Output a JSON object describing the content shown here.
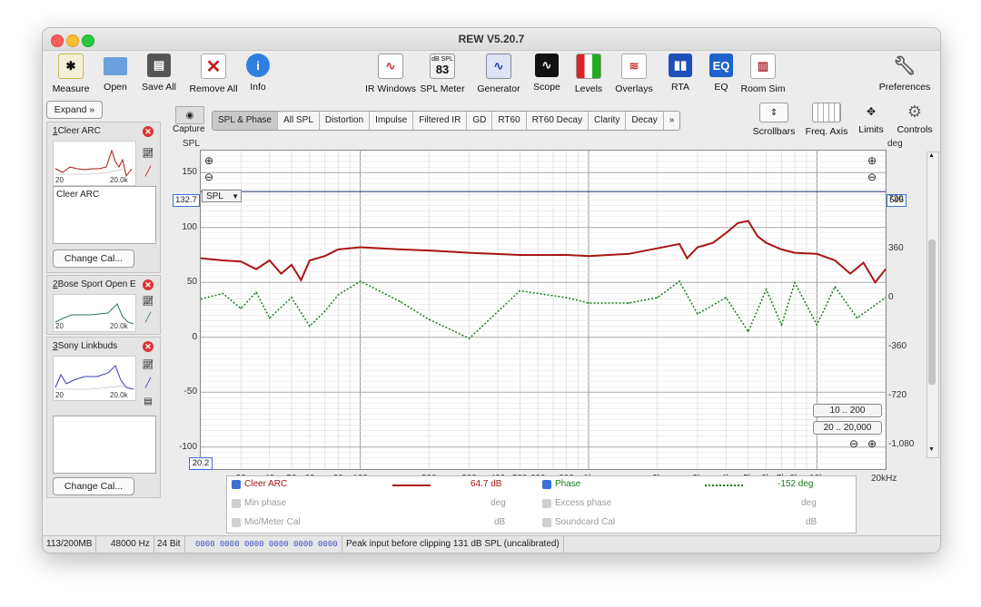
{
  "window": {
    "title": "REW V5.20.7"
  },
  "toolbar": {
    "measure": "Measure",
    "open": "Open",
    "save_all": "Save All",
    "remove_all": "Remove All",
    "info": "Info",
    "ir_windows": "IR Windows",
    "spl_meter": "SPL Meter",
    "spl_meter_top": "dB SPL",
    "spl_meter_value": "83",
    "generator": "Generator",
    "scope": "Scope",
    "levels": "Levels",
    "overlays": "Overlays",
    "rta": "RTA",
    "eq": "EQ",
    "eq_icon": "EQ",
    "room_sim": "Room Sim",
    "preferences": "Preferences"
  },
  "sidebar": {
    "expand": "Expand",
    "measurements": [
      {
        "num": "1",
        "name": "Cleer ARC",
        "note": "Cleer ARC",
        "axis_lo": "20",
        "axis_hi": "20.0k",
        "button": "Change Cal..."
      },
      {
        "num": "2",
        "name": "Bose Sport Open E",
        "axis_lo": "20",
        "axis_hi": "20.0k"
      },
      {
        "num": "3",
        "name": "Sony Linkbuds",
        "axis_lo": "20",
        "axis_hi": "20.0k",
        "button": "Change Cal..."
      }
    ]
  },
  "capture": "Capture",
  "tabs": [
    "SPL & Phase",
    "All SPL",
    "Distortion",
    "Impulse",
    "Filtered IR",
    "GD",
    "RT60",
    "RT60 Decay",
    "Clarity",
    "Decay",
    "»"
  ],
  "right_controls": {
    "scrollbars": "Scrollbars",
    "freq_axis": "Freq. Axis",
    "limits": "Limits",
    "controls": "Controls"
  },
  "chart": {
    "left_unit": "SPL",
    "right_unit": "deg",
    "left_ticks": [
      "150",
      "100",
      "50",
      "0",
      "-50",
      "-100"
    ],
    "right_ticks": [
      "720",
      "360",
      "0",
      "-360",
      "-720",
      "-1,080"
    ],
    "x_ticks": [
      "30",
      "40",
      "50",
      "60",
      "80",
      "100",
      "200",
      "300",
      "400",
      "500",
      "600",
      "800",
      "1k",
      "2k",
      "3k",
      "4k",
      "5k",
      "6k",
      "7k",
      "8k",
      "10k",
      "20kHz"
    ],
    "cursor_left": "132.7",
    "cursor_right": "595",
    "cursor_x": "20.2",
    "dropdown": "SPL",
    "range_btn_1": "10 .. 200",
    "range_btn_2": "20 .. 20,000"
  },
  "chart_data": {
    "type": "line",
    "x_scale": "log",
    "xlim": [
      20,
      20000
    ],
    "ylim": [
      -120,
      170
    ],
    "y2lim": [
      -1260,
      1080
    ],
    "grid": true,
    "series": [
      {
        "name": "Cleer ARC",
        "axis": "left",
        "color": "#a81515",
        "x": [
          20,
          25,
          30,
          35,
          40,
          45,
          50,
          55,
          60,
          70,
          80,
          100,
          150,
          200,
          300,
          500,
          800,
          1000,
          1500,
          2000,
          2500,
          2700,
          3000,
          3500,
          4000,
          4500,
          5000,
          5500,
          6000,
          7000,
          8000,
          10000,
          12000,
          14000,
          16000,
          18000,
          20000
        ],
        "y": [
          72,
          70,
          69,
          62,
          70,
          58,
          66,
          52,
          70,
          74,
          80,
          82,
          80,
          79,
          77,
          75,
          75,
          74,
          76,
          81,
          85,
          72,
          82,
          86,
          95,
          104,
          106,
          92,
          86,
          80,
          77,
          76,
          70,
          58,
          68,
          50,
          62
        ]
      },
      {
        "name": "Phase",
        "axis": "right",
        "color": "#1d7a1d",
        "x": [
          20,
          25,
          30,
          35,
          40,
          50,
          60,
          70,
          80,
          100,
          150,
          200,
          300,
          500,
          800,
          1000,
          1500,
          2000,
          2500,
          3000,
          4000,
          5000,
          6000,
          7000,
          8000,
          10000,
          12000,
          15000,
          20000
        ],
        "y": [
          -10,
          30,
          -80,
          40,
          -150,
          0,
          -210,
          -100,
          20,
          120,
          -30,
          -160,
          -300,
          50,
          0,
          -40,
          -40,
          0,
          120,
          -120,
          0,
          -250,
          60,
          -200,
          110,
          -200,
          80,
          -150,
          0
        ]
      }
    ]
  },
  "legend": {
    "row1": {
      "name": "Cleer ARC",
      "value": "64.7 dB",
      "name2": "Phase",
      "value2": "-152 deg"
    },
    "row2": {
      "name": "Min phase",
      "value": "deg",
      "name2": "Excess phase",
      "value2": "deg"
    },
    "row3": {
      "name": "Mic/Meter Cal",
      "value": "dB",
      "name2": "Soundcard Cal",
      "value2": "dB"
    }
  },
  "status": {
    "memory": "113/200MB",
    "rate": "48000 Hz",
    "bits": "24 Bit",
    "levels": "0000 0000  0000 0000  0000 0000",
    "message": "Peak input before clipping 131 dB SPL (uncalibrated)"
  },
  "colors": {
    "spl": "#a81515",
    "phase": "#1d7a1d",
    "accent": "#3b6fd8"
  }
}
